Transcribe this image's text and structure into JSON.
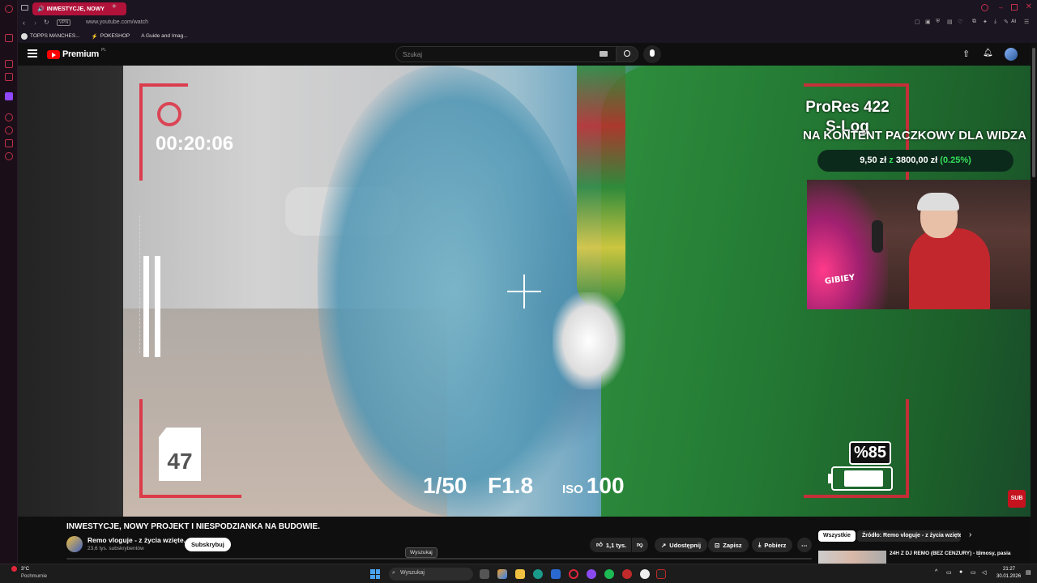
{
  "browser": {
    "tab_title": "INWESTYCJE, NOWY",
    "url": "www.youtube.com/watch",
    "vpn_label": "VPN",
    "ai_label": "AI",
    "bookmarks": [
      "TOPPS MANCHES...",
      "POKESHOP",
      "A Guide and Imag..."
    ]
  },
  "yt_header": {
    "logo": "Premium",
    "logo_region": "PL",
    "search_placeholder": "Szukaj"
  },
  "video_overlay": {
    "timecode": "00:20:06",
    "sd_number": "47",
    "shutter": "1/50",
    "aperture": "F1.8",
    "iso_label": "ISO",
    "iso_value": "100",
    "battery_pct": "%85",
    "battery_level": 0.85,
    "prores_line1": "ProRes 422",
    "prores_line2": "S-Log",
    "donation_title": "NA KONTENT PACZKOWY DLA WIDZA",
    "donation_current": "9,50 zł",
    "donation_sep": "z",
    "donation_goal": "3800,00 zł",
    "donation_pct": "(0.25%)",
    "webcam_logo": "GIBIEY",
    "sub_badge": "SUB"
  },
  "below_video": {
    "title": "INWESTYCJE, NOWY PROJEKT I NIESPODZIANKA NA BUDOWIE.",
    "channel": "Remo vloguje - z życia wzięte.",
    "subscribers": "23,6 tys. subskrybentów",
    "subscribe_label": "Subskrybuj",
    "likes": "1,1 tys.",
    "share": "Udostępnij",
    "save": "Zapisz",
    "download": "Pobierz",
    "chip_all": "Wszystkie",
    "chip_source": "Źródło: Remo vloguje - z życia wzięte.",
    "recommended_title": "24H Z DJ REMO (BEZ CENZURY) - bimosy, pasia",
    "tooltip": "Wyszukaj"
  },
  "taskbar": {
    "temperature": "3°C",
    "weather": "Pochmurnie",
    "search": "Wyszukaj",
    "time": "21:27",
    "date": "30.01.2026"
  },
  "colors": {
    "accent_red": "#e0263a",
    "tab_red": "#b0123a",
    "donation_green": "#35e05a"
  }
}
